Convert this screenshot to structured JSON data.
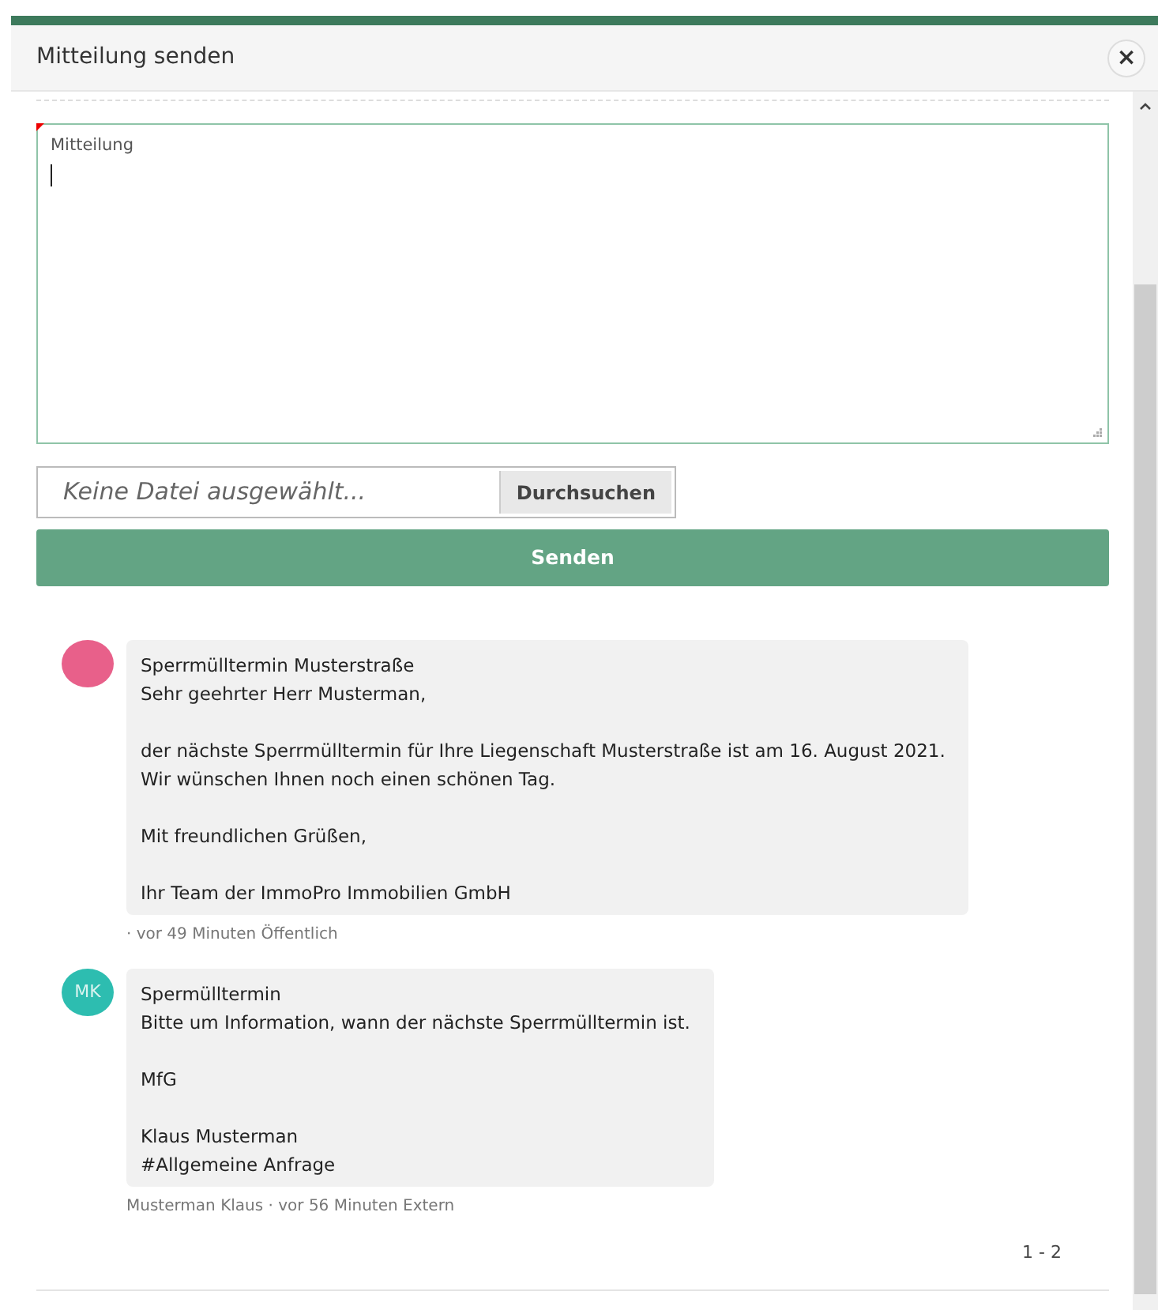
{
  "dialog": {
    "title": "Mitteilung senden",
    "close_label": "×"
  },
  "message_field": {
    "label": "Mitteilung",
    "required": true
  },
  "file_input": {
    "placeholder": "Keine Datei ausgewählt...",
    "button": "Durchsuchen"
  },
  "send_button": "Senden",
  "messages": [
    {
      "color": "#e8608a",
      "subject": "Sperrmülltermin Musterstraße",
      "paragraphs": [
        [
          "Sehr geehrter Herr Musterman,"
        ],
        [
          "der nächste Sperrmülltermin für Ihre Liegenschaft Musterstraße ist am 16. August 2021.",
          "Wir wünschen Ihnen noch einen schönen Tag."
        ],
        [
          "Mit freundlichen Grüßen,"
        ],
        [
          "Ihr Team der ImmoPro Immobilien GmbH"
        ]
      ],
      "meta": "· vor 49 Minuten Öffentlich"
    },
    {
      "initials": "MK",
      "color": "#2dbdb0",
      "subject": "Spermülltermin",
      "paragraphs": [
        [
          "Bitte um Information, wann der nächste Sperrmülltermin ist."
        ],
        [
          "MfG"
        ],
        [
          "Klaus Musterman",
          "#Allgemeine Anfrage"
        ]
      ],
      "meta": "Musterman Klaus · vor 56 Minuten Extern"
    }
  ],
  "pagination": "1 - 2"
}
